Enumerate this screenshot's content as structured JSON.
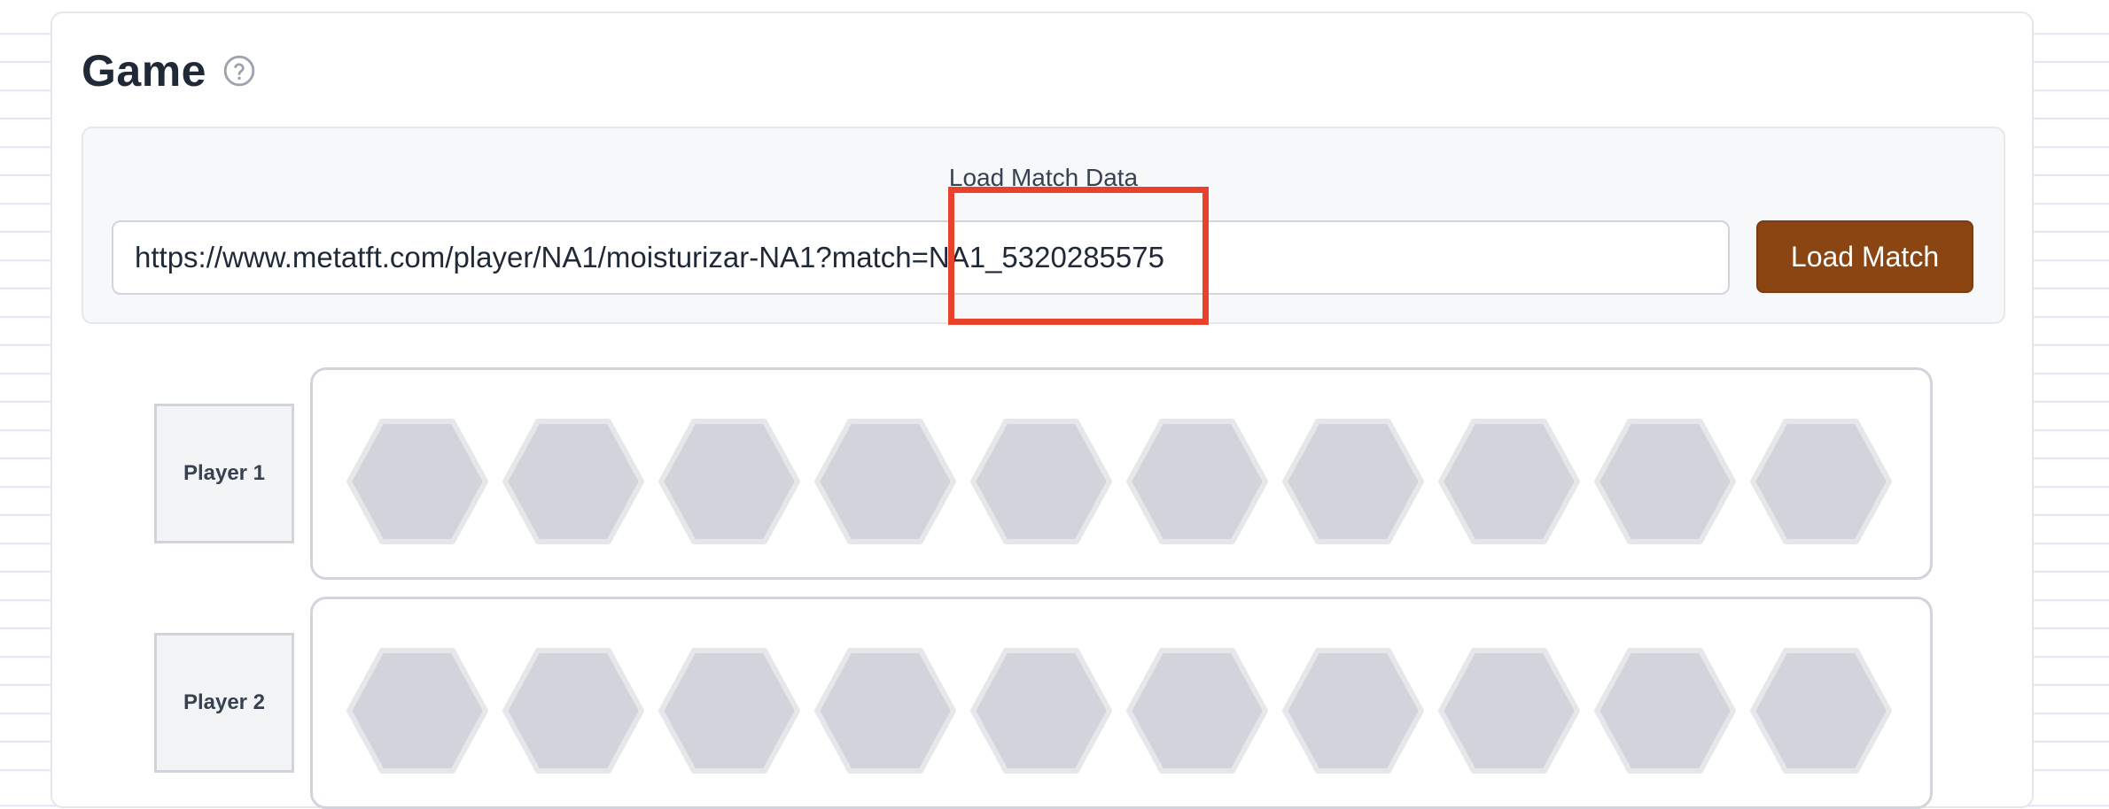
{
  "game": {
    "title": "Game",
    "help_icon": "question-circle-icon"
  },
  "load_panel": {
    "label": "Load Match Data",
    "url_value": "https://www.metatft.com/player/NA1/moisturizar-NA1?match=NA1_5320285575",
    "button_label": "Load Match",
    "highlighted_text": "NA1_5320285575"
  },
  "colors": {
    "button_bg": "#8b4513",
    "highlight_border": "#e8412c",
    "hex_fill": "#d1d5db",
    "hex_stroke": "#e5e7eb"
  },
  "players": [
    {
      "label": "Player 1",
      "slot_count": 10
    },
    {
      "label": "Player 2",
      "slot_count": 10
    }
  ]
}
